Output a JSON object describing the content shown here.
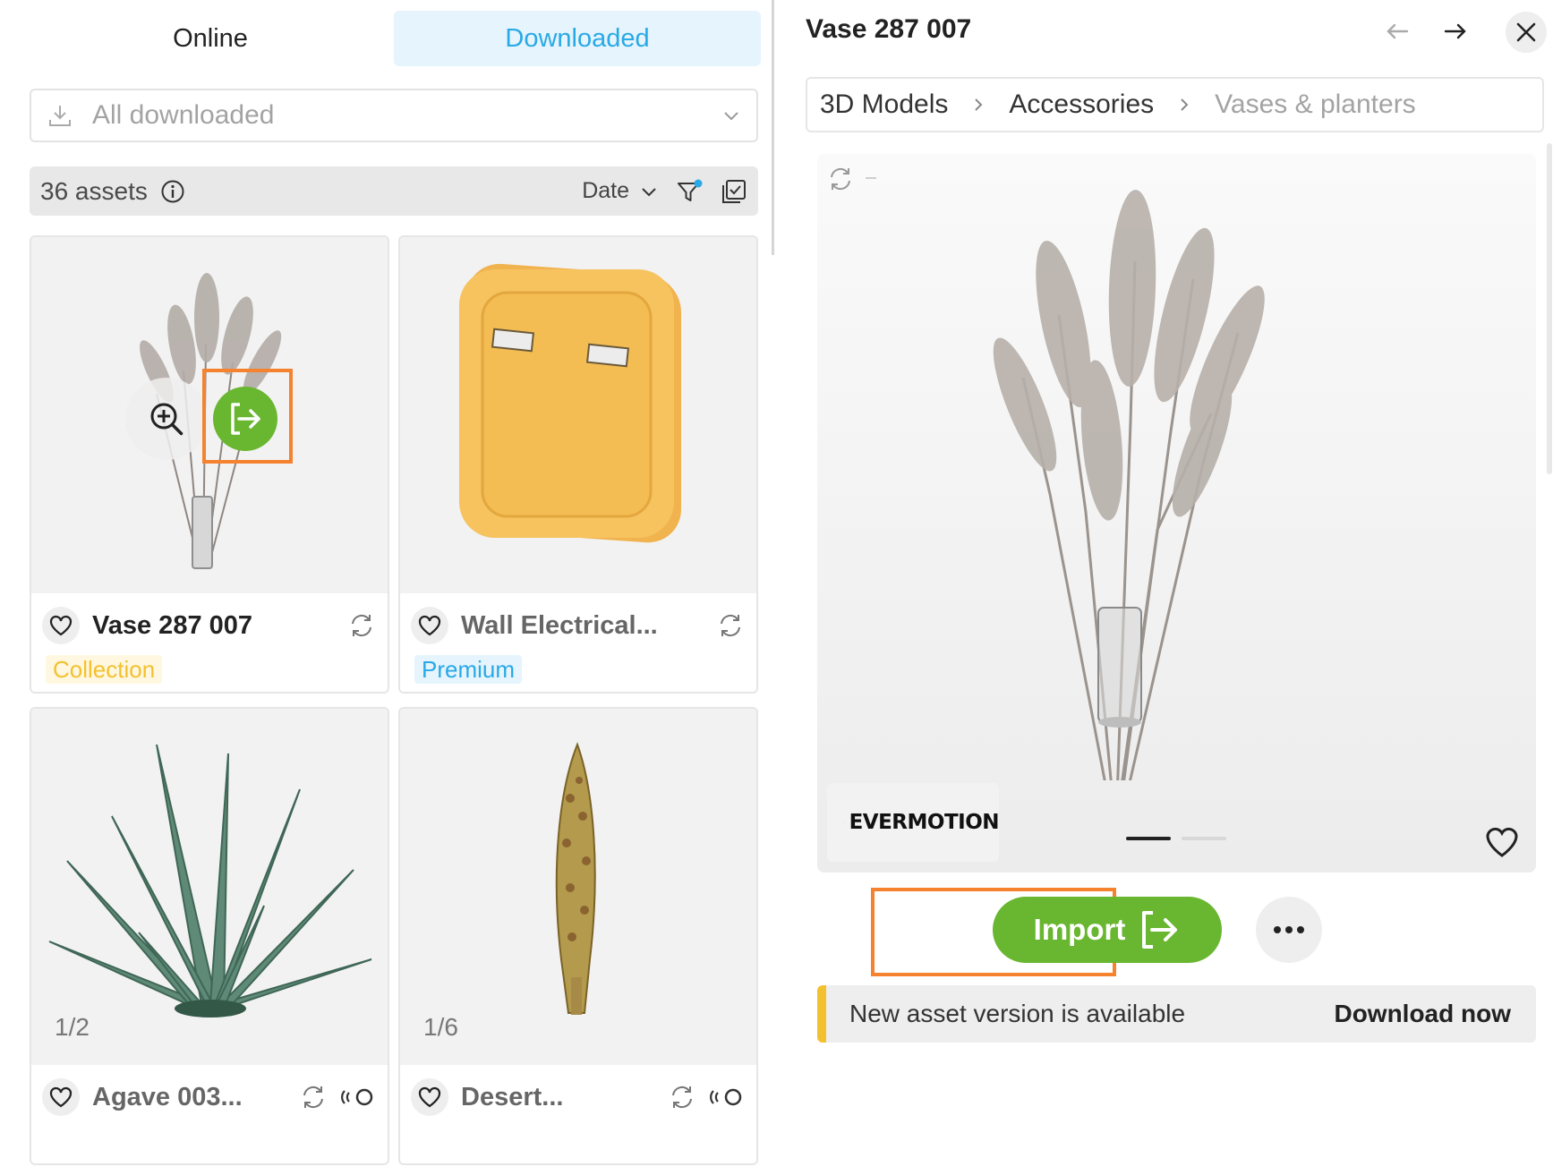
{
  "tabs": {
    "online": "Online",
    "downloaded": "Downloaded",
    "active": "downloaded"
  },
  "filter": {
    "value": "All downloaded"
  },
  "toolbar": {
    "count": "36 assets",
    "sort": "Date"
  },
  "cards": [
    {
      "name": "Vase 287 007",
      "badge": "Collection",
      "counter": ""
    },
    {
      "name": "Wall Electrical...",
      "badge": "Premium",
      "counter": ""
    },
    {
      "name": "Agave 003...",
      "badge": "",
      "counter": "1/2"
    },
    {
      "name": "Desert...",
      "badge": "",
      "counter": "1/6"
    }
  ],
  "detail": {
    "title": "Vase 287 007",
    "breadcrumb": [
      "3D Models",
      "Accessories",
      "Vases & planters"
    ],
    "logo": "EVERMOTION",
    "slides": {
      "current": 1,
      "total": 2
    },
    "import_label": "Import",
    "notice_text": "New asset version is available",
    "notice_action": "Download now"
  },
  "colors": {
    "accent_blue": "#29a9e6",
    "green": "#69b630",
    "highlight": "#f5822e",
    "collection": "#f3c12f"
  },
  "icons": [
    "download-icon",
    "chevron-down-icon",
    "info-icon",
    "filter-icon",
    "select-all-icon",
    "heart-icon",
    "sync-icon",
    "vr-icon",
    "zoom-in-icon",
    "import-icon",
    "arrow-left-icon",
    "arrow-right-icon",
    "close-icon",
    "more-icon"
  ]
}
